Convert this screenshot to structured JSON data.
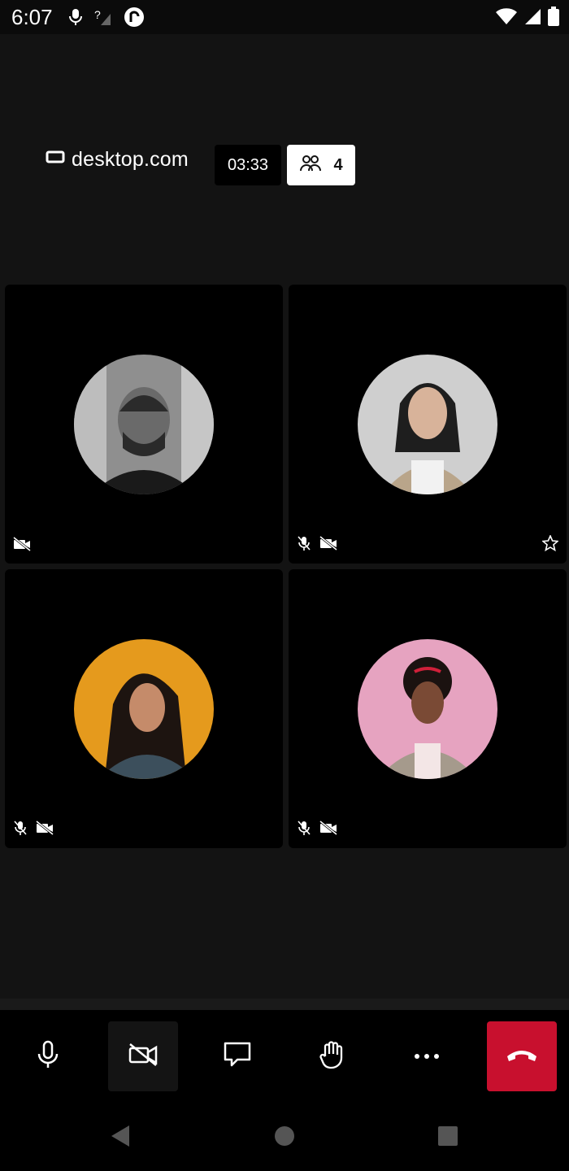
{
  "status_bar": {
    "time": "6:07",
    "icons_left": [
      "mic-icon",
      "no-signal-icon",
      "app-icon"
    ],
    "icons_right": [
      "wifi-icon",
      "cell-signal-icon",
      "battery-icon"
    ]
  },
  "header": {
    "brand": "desktop.com",
    "timer": "03:33",
    "participants_count": "4"
  },
  "participants": [
    {
      "id": "p1",
      "muted": false,
      "video_off": true,
      "starred": false,
      "avatar_bg": "#8a8a8a"
    },
    {
      "id": "p2",
      "muted": true,
      "video_off": true,
      "starred": true,
      "avatar_bg": "#cfcfcf"
    },
    {
      "id": "p3",
      "muted": true,
      "video_off": true,
      "starred": false,
      "avatar_bg": "#e59a1d"
    },
    {
      "id": "p4",
      "muted": true,
      "video_off": true,
      "starred": false,
      "avatar_bg": "#e6a3c0"
    }
  ],
  "toolbar": {
    "buttons": [
      "microphone-button",
      "camera-off-button",
      "chat-button",
      "raise-hand-button",
      "more-options-button",
      "hang-up-button"
    ],
    "hangup_color": "#c8102e"
  },
  "nav_bar": {
    "buttons": [
      "back-button",
      "home-button",
      "recents-button"
    ]
  }
}
